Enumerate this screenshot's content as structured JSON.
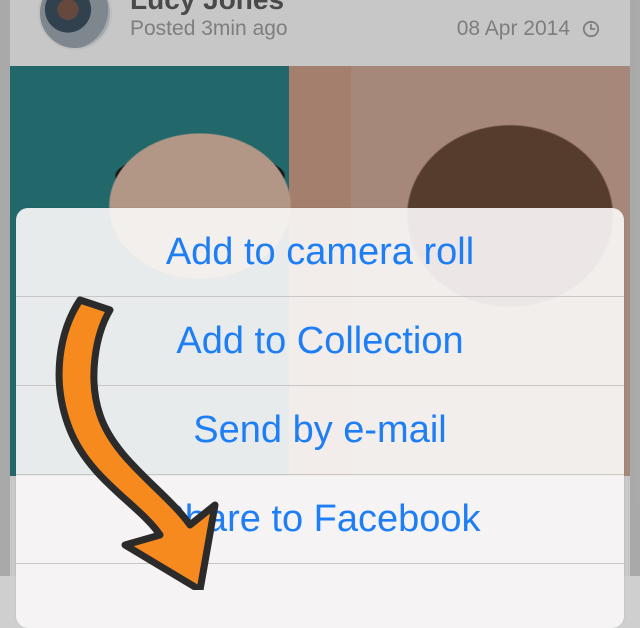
{
  "post": {
    "author": "Lucy Jones",
    "posted": "Posted 3min ago",
    "date": "08 Apr 2014"
  },
  "icons": {
    "avatar": "avatar-photo",
    "clock": "clock-icon",
    "arrow": "orange-arrow-icon"
  },
  "action_sheet": {
    "items": [
      {
        "label": "Add to camera roll"
      },
      {
        "label": "Add to Collection"
      },
      {
        "label": "Send by e-mail"
      },
      {
        "label": "Share to Facebook"
      }
    ]
  },
  "colors": {
    "action_text": "#1e7ef5",
    "arrow_fill": "#f68a1e",
    "arrow_outline": "#2b2b2b"
  }
}
